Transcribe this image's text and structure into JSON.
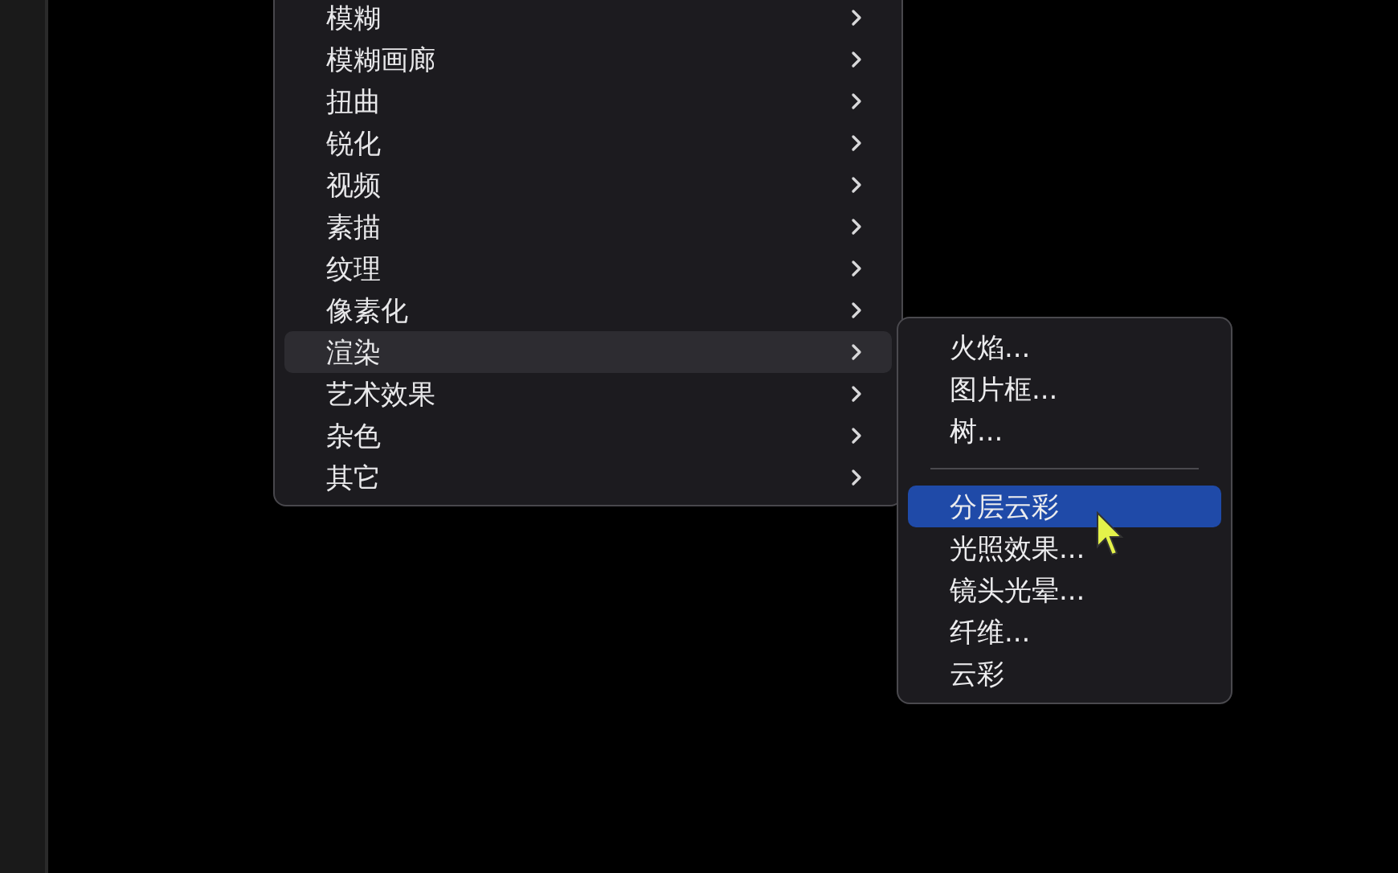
{
  "menu": {
    "items": [
      {
        "label": "模糊",
        "selected": false
      },
      {
        "label": "模糊画廊",
        "selected": false
      },
      {
        "label": "扭曲",
        "selected": false
      },
      {
        "label": "锐化",
        "selected": false
      },
      {
        "label": "视频",
        "selected": false
      },
      {
        "label": "素描",
        "selected": false
      },
      {
        "label": "纹理",
        "selected": false
      },
      {
        "label": "像素化",
        "selected": false
      },
      {
        "label": "渲染",
        "selected": true
      },
      {
        "label": "艺术效果",
        "selected": false
      },
      {
        "label": "杂色",
        "selected": false
      },
      {
        "label": "其它",
        "selected": false
      }
    ]
  },
  "submenu": {
    "items": [
      {
        "kind": "item",
        "label": "火焰...",
        "selected": false
      },
      {
        "kind": "item",
        "label": "图片框...",
        "selected": false
      },
      {
        "kind": "item",
        "label": "树...",
        "selected": false
      },
      {
        "kind": "separator"
      },
      {
        "kind": "item",
        "label": "分层云彩",
        "selected": true
      },
      {
        "kind": "item",
        "label": "光照效果...",
        "selected": false
      },
      {
        "kind": "item",
        "label": "镜头光晕...",
        "selected": false
      },
      {
        "kind": "item",
        "label": "纤维...",
        "selected": false
      },
      {
        "kind": "item",
        "label": "云彩",
        "selected": false
      }
    ]
  }
}
